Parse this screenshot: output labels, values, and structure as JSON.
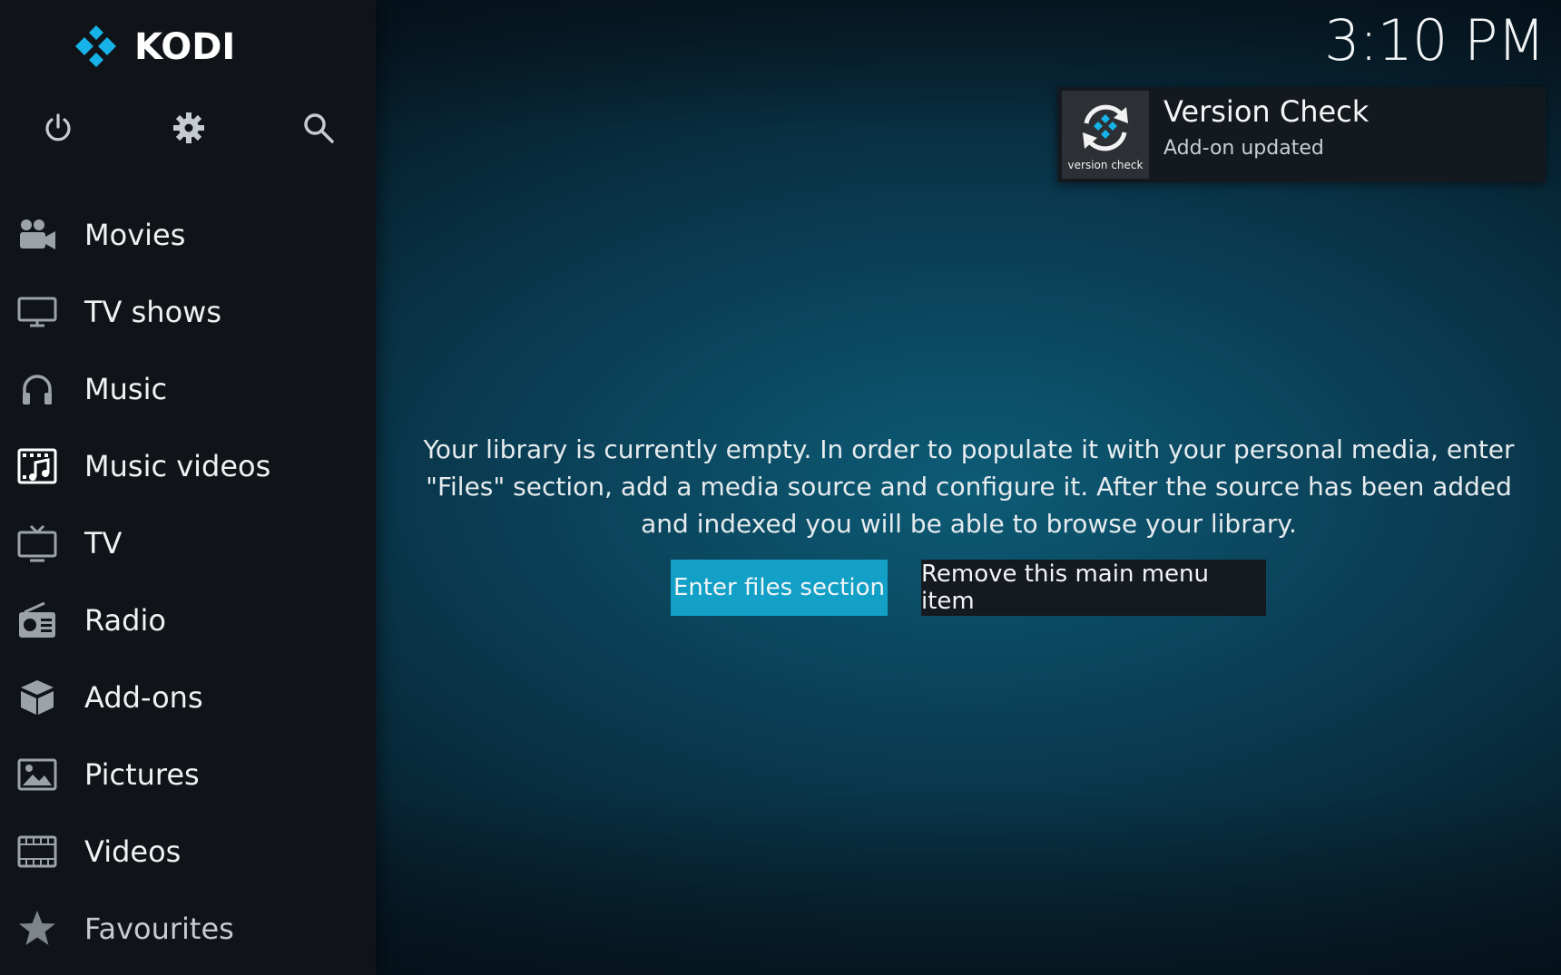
{
  "app": {
    "name": "KODI",
    "clock": "3:10 PM"
  },
  "sidebar": {
    "top_icons": [
      {
        "name": "power-icon"
      },
      {
        "name": "gear-icon"
      },
      {
        "name": "search-icon"
      }
    ],
    "items": [
      {
        "label": "Movies",
        "icon": "movie-camera-icon"
      },
      {
        "label": "TV shows",
        "icon": "monitor-icon"
      },
      {
        "label": "Music",
        "icon": "headphones-icon"
      },
      {
        "label": "Music videos",
        "icon": "music-video-icon"
      },
      {
        "label": "TV",
        "icon": "tv-icon"
      },
      {
        "label": "Radio",
        "icon": "radio-icon"
      },
      {
        "label": "Add-ons",
        "icon": "addon-box-icon"
      },
      {
        "label": "Pictures",
        "icon": "picture-icon"
      },
      {
        "label": "Videos",
        "icon": "film-strip-icon"
      },
      {
        "label": "Favourites",
        "icon": "star-icon"
      }
    ]
  },
  "notification": {
    "title": "Version Check",
    "subtitle": "Add-on updated",
    "thumb_caption": "version check"
  },
  "main": {
    "message": "Your library is currently empty. In order to populate it with your personal media, enter \"Files\" section, add a media source and configure it. After the source has been added and indexed you will be able to browse your library.",
    "primary_button": "Enter files section",
    "secondary_button": "Remove this main menu item"
  },
  "colors": {
    "accent": "#12a0c7",
    "sidebar_bg": "#101418",
    "background": "#0a3c52",
    "logo_blue": "#17b2e7"
  }
}
